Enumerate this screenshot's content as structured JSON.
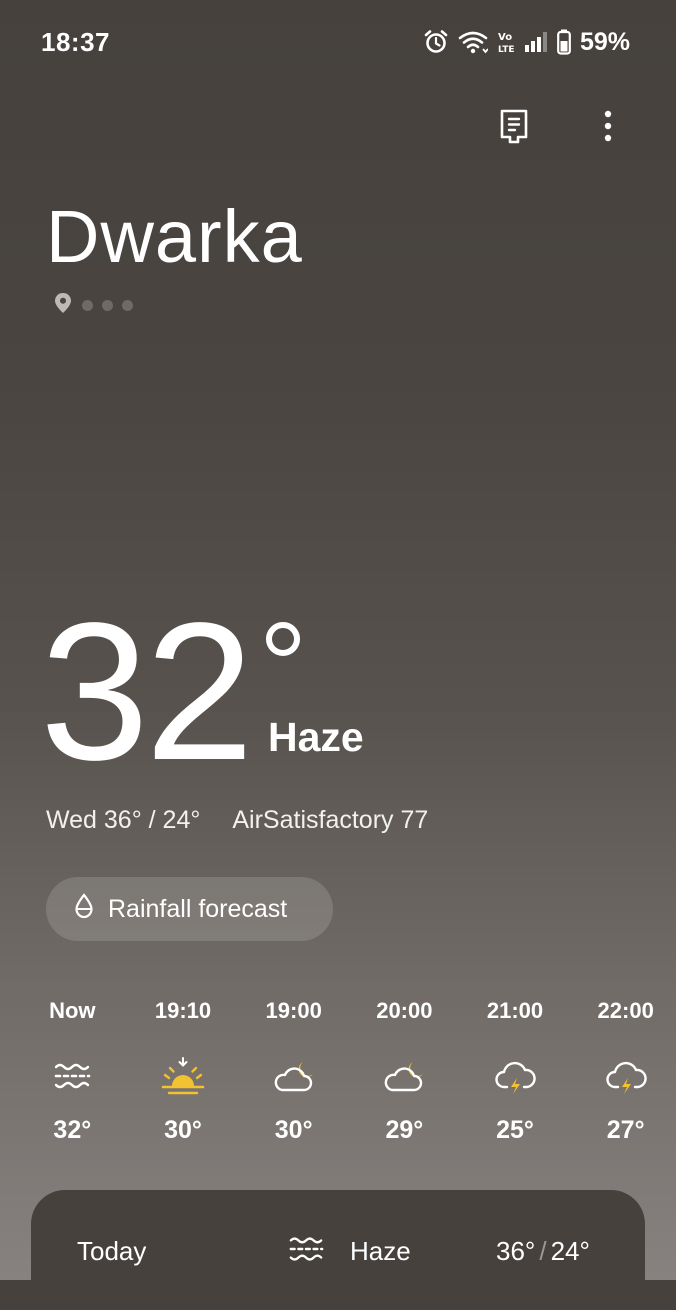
{
  "status_bar": {
    "time": "18:37",
    "battery_percent": "59%",
    "icons": [
      "alarm-icon",
      "wifi-icon",
      "volte-icon",
      "signal-icon",
      "battery-icon"
    ]
  },
  "header": {
    "actions": [
      "document-icon",
      "more-vertical-icon"
    ]
  },
  "location": {
    "city": "Dwarka",
    "page_count": 4,
    "current_page": 0
  },
  "current": {
    "temperature": "32",
    "condition": "Haze",
    "day_range": "Wed 36° / 24°",
    "air_quality": "AirSatisfactory 77"
  },
  "rainfall_button": {
    "label": "Rainfall forecast",
    "icon": "droplet-icon"
  },
  "hourly": [
    {
      "time": "Now",
      "icon": "haze-icon",
      "temp": "32°"
    },
    {
      "time": "19:10",
      "icon": "sunset-icon",
      "temp": "30°"
    },
    {
      "time": "19:00",
      "icon": "partly-cloudy-night-icon",
      "temp": "30°"
    },
    {
      "time": "20:00",
      "icon": "partly-cloudy-night-icon",
      "temp": "29°"
    },
    {
      "time": "21:00",
      "icon": "thunderstorm-icon",
      "temp": "25°"
    },
    {
      "time": "22:00",
      "icon": "thunderstorm-icon",
      "temp": "27°"
    }
  ],
  "daily": [
    {
      "day": "Today",
      "icon": "haze-icon",
      "condition": "Haze",
      "high": "36°",
      "low": "24°"
    }
  ],
  "colors": {
    "accent_yellow": "#f2c230",
    "card_bg": "#46413d"
  }
}
